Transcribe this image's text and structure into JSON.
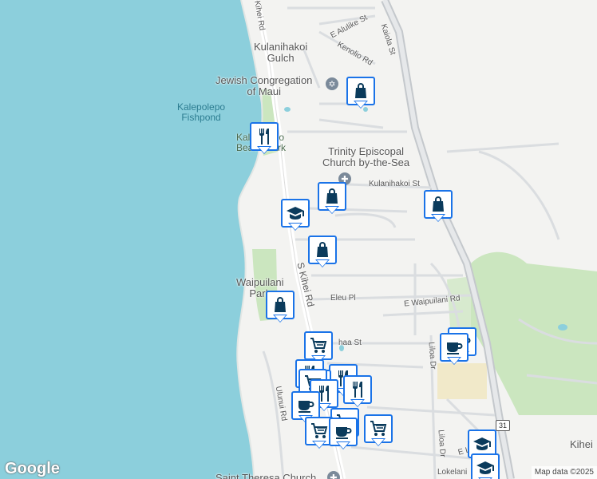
{
  "map": {
    "places": {
      "kulanihakoi_gulch": "Kulanihakoi\nGulch",
      "jewish_congregation": "Jewish Congregation\nof Maui",
      "kalepolepo_fishpond": "Kalepolepo\nFishpond",
      "kalepolepo_beach_park": "Kalepolepo\nBeach Park",
      "trinity_church": "Trinity Episcopal\nChurch by-the-Sea",
      "waipuilani_park": "Waipuilani\nPark",
      "saint_theresa_church": "Saint Theresa Church",
      "kihei": "Kihei"
    },
    "roads": {
      "kihei_rd_top": "Kihei Rd",
      "e_alulike_st": "E Alulike St",
      "kaiola_st": "Kaiola St",
      "kenolio_rd": "Kenolio Rd",
      "kulanihakoi_st": "Kulanihakoi St",
      "s_kihei_rd": "S Kihei Rd",
      "eleu_pl": "Eleu Pl",
      "e_waipuilani_rd": "E Waipuilani Rd",
      "haa_st": "haa St",
      "liloa_dr": "Liloa Dr",
      "liloa_dr_2": "Liloa Dr",
      "ulunui_rd": "Ulunui Rd",
      "e_l_partial": "E L",
      "lokelani_partial": "Lokelani"
    },
    "highway_shield": "31",
    "logo": "Google",
    "credit": "Map data ©2025",
    "colors": {
      "water": "#8ccfdc",
      "land": "#f3f3f1",
      "park": "#cbe6bf",
      "marker_border": "#1a73e8",
      "icon_fill": "#0b3b5c",
      "highway": "#c4c8cc"
    },
    "markers": [
      {
        "icon": "shopping-bag-icon"
      },
      {
        "icon": "restaurant-icon"
      },
      {
        "icon": "shopping-bag-icon"
      },
      {
        "icon": "school-icon"
      },
      {
        "icon": "shopping-bag-icon"
      },
      {
        "icon": "shopping-bag-icon"
      },
      {
        "icon": "shopping-bag-icon"
      },
      {
        "icon": "grocery-cart-icon"
      },
      {
        "icon": "cafe-icon"
      },
      {
        "icon": "cafe-icon"
      },
      {
        "icon": "restaurant-icon"
      },
      {
        "icon": "restaurant-icon"
      },
      {
        "icon": "restaurant-icon"
      },
      {
        "icon": "grocery-cart-icon"
      },
      {
        "icon": "restaurant-icon"
      },
      {
        "icon": "restaurant-icon"
      },
      {
        "icon": "cafe-icon"
      },
      {
        "icon": "grocery-cart-icon"
      },
      {
        "icon": "grocery-cart-icon"
      },
      {
        "icon": "cafe-icon"
      },
      {
        "icon": "grocery-cart-icon"
      },
      {
        "icon": "school-icon"
      },
      {
        "icon": "school-icon"
      }
    ]
  }
}
